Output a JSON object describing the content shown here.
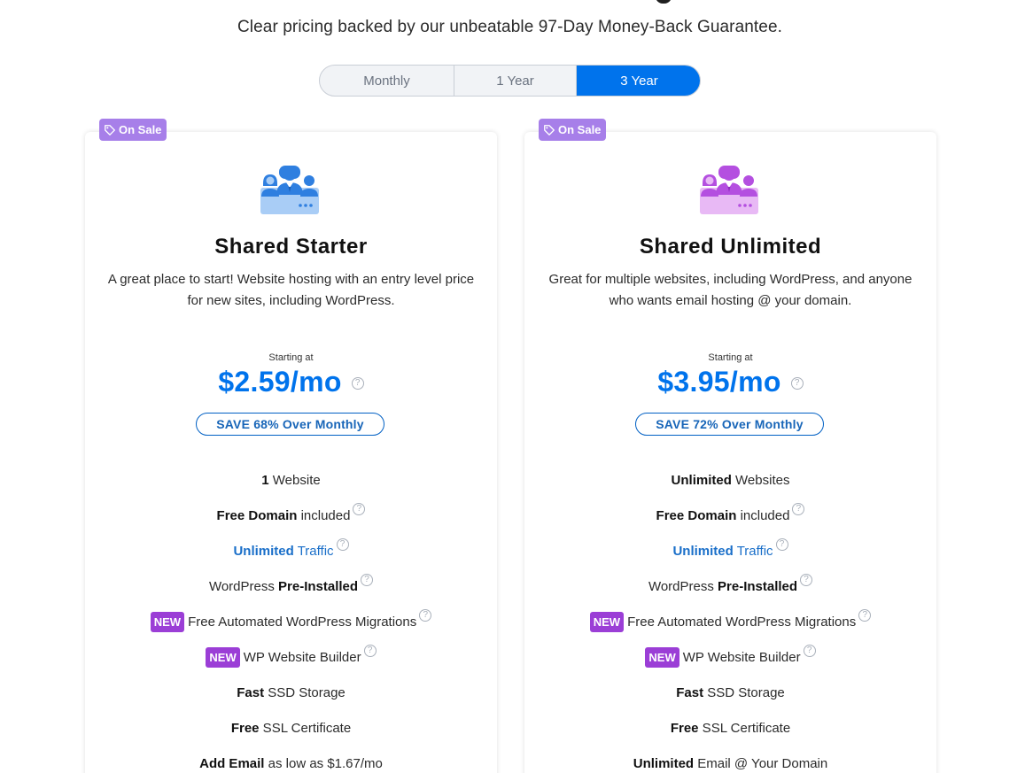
{
  "header": {
    "subtitle": "Clear pricing backed by our unbeatable 97-Day Money-Back Guarantee."
  },
  "term_toggle": {
    "options": [
      "Monthly",
      "1 Year",
      "3 Year"
    ],
    "selected": "3 Year"
  },
  "colors": {
    "accent": "#0073ec",
    "sale_badge": "#a77fe9",
    "new_tag": "#9b3ed6",
    "starter_icon": "#2f7fe0",
    "unlimited_icon": "#b44fe0"
  },
  "plans": [
    {
      "badge": "On Sale",
      "icon": "team-icon",
      "name": "Shared Starter",
      "description": "A great place to start! Website hosting with an entry level price for new sites, including WordPress.",
      "starting_label": "Starting at",
      "price": "$2.59/mo",
      "save": "SAVE 68% Over Monthly",
      "features": {
        "websites_strong": "1",
        "websites_rest": " Website",
        "domain_strong": "Free Domain",
        "domain_rest": " included",
        "traffic_strong": "Unlimited",
        "traffic_rest": " Traffic",
        "wp_rest": "WordPress ",
        "wp_strong": "Pre-Installed",
        "new_label": "NEW",
        "migrations": "Free Automated WordPress Migrations",
        "builder": "WP Website Builder",
        "storage_strong": "Fast",
        "storage_rest": " SSD Storage",
        "ssl_strong": "Free",
        "ssl_rest": " SSL Certificate",
        "email_strong": "Add Email",
        "email_rest": " as low as $1.67/mo"
      }
    },
    {
      "badge": "On Sale",
      "icon": "team-icon",
      "name": "Shared Unlimited",
      "description": "Great for multiple websites, including WordPress, and anyone who wants email hosting @ your domain.",
      "starting_label": "Starting at",
      "price": "$3.95/mo",
      "save": "SAVE 72% Over Monthly",
      "features": {
        "websites_strong": "Unlimited",
        "websites_rest": " Websites",
        "domain_strong": "Free Domain",
        "domain_rest": " included",
        "traffic_strong": "Unlimited",
        "traffic_rest": " Traffic",
        "wp_rest": "WordPress ",
        "wp_strong": "Pre-Installed",
        "new_label": "NEW",
        "migrations": "Free Automated WordPress Migrations",
        "builder": "WP Website Builder",
        "storage_strong": "Fast",
        "storage_rest": " SSD Storage",
        "ssl_strong": "Free",
        "ssl_rest": " SSL Certificate",
        "email_strong": "Unlimited",
        "email_rest": " Email @ Your Domain"
      }
    }
  ]
}
